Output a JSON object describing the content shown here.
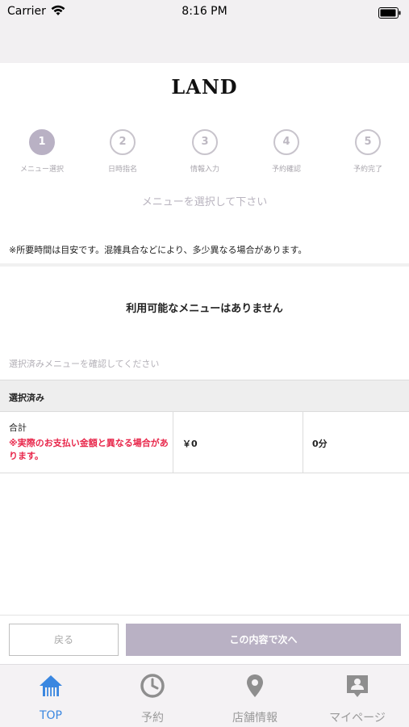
{
  "status_bar": {
    "carrier": "Carrier",
    "time": "8:16 PM"
  },
  "brand": "LAND",
  "steps": [
    {
      "number": "1",
      "label": "メニュー選択",
      "active": true
    },
    {
      "number": "2",
      "label": "日時指名",
      "active": false
    },
    {
      "number": "3",
      "label": "情報入力",
      "active": false
    },
    {
      "number": "4",
      "label": "予約確認",
      "active": false
    },
    {
      "number": "5",
      "label": "予約完了",
      "active": false
    }
  ],
  "instruction": "メニューを選択して下さい",
  "notice": "※所要時間は目安です。混雑具合などにより、多少異なる場合があります。",
  "empty_message": "利用可能なメニューはありません",
  "confirm_hint": "選択済みメニューを確認してください",
  "selected": {
    "header": "選択済み",
    "total_label": "合計",
    "warning": "※実際のお支払い金額と異なる場合があります。",
    "price": "￥0",
    "duration": "0分"
  },
  "buttons": {
    "back": "戻る",
    "next": "この内容で次へ"
  },
  "tabs": [
    {
      "label": "TOP",
      "icon": "home-icon",
      "active": true
    },
    {
      "label": "予約",
      "icon": "clock-icon",
      "active": false
    },
    {
      "label": "店舗情報",
      "icon": "location-pin-icon",
      "active": false
    },
    {
      "label": "マイページ",
      "icon": "user-badge-icon",
      "active": false
    }
  ],
  "colors": {
    "accent": "#b9b1c4",
    "active_tab": "#3a87e0",
    "warning": "#e8264a",
    "inactive_icon": "#8e8e8e"
  }
}
